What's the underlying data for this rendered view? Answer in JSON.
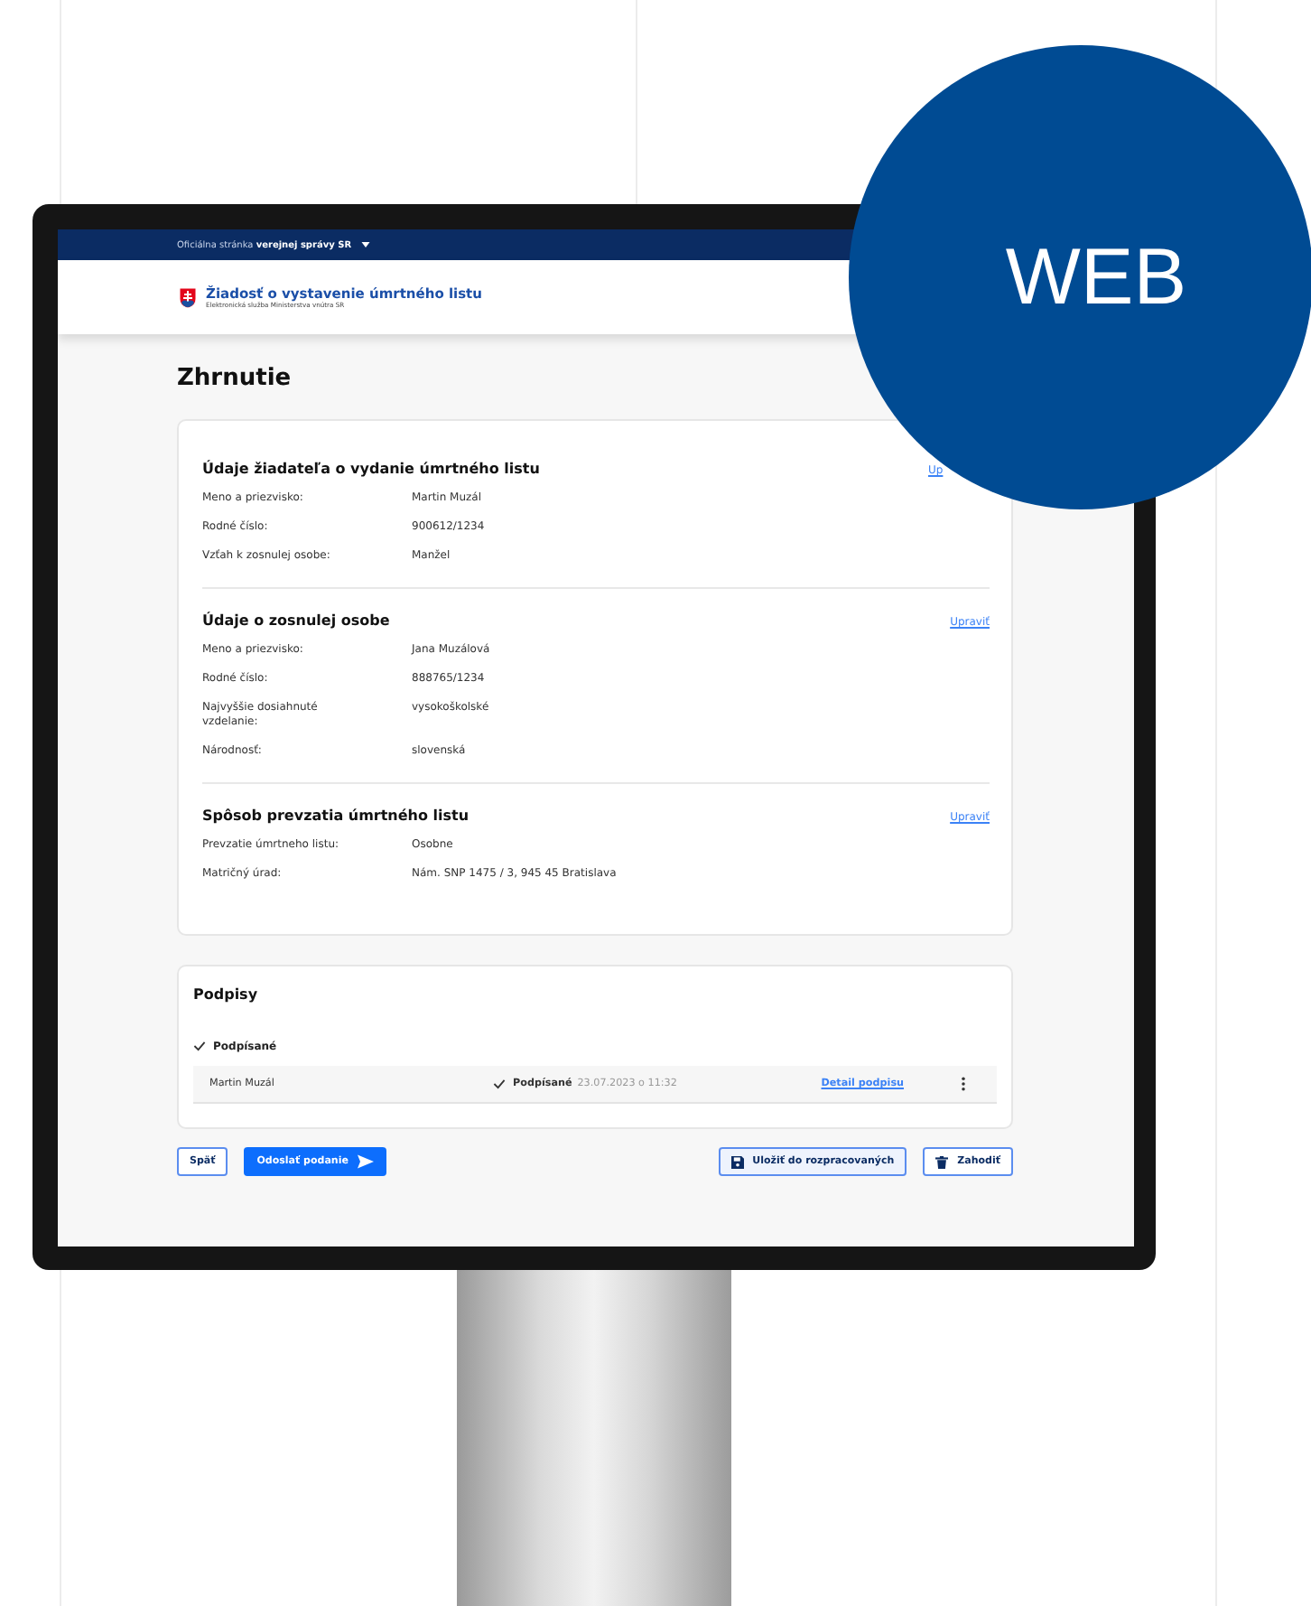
{
  "top_bar": {
    "text": "Oficiálna stránka **verejnej správy SR**"
  },
  "header": {
    "title": "Žiadosť o vystavenie úmrtného listu",
    "subtitle": "Elektronická služba Ministerstva vnútra SR"
  },
  "page_title": "Zhrnutie",
  "sections": [
    {
      "title": "Údaje žiadateľa o vydanie úmrtného listu",
      "edit_link": "Up",
      "rows": [
        {
          "label": "Meno a priezvisko:",
          "value": "Martin Muzál"
        },
        {
          "label": "Rodné číslo:",
          "value": "900612/1234"
        },
        {
          "label": "Vzťah k zosnulej osobe:",
          "value": "Manžel"
        }
      ]
    },
    {
      "title": "Údaje o zosnulej osobe",
      "edit_link": "Upraviť",
      "rows": [
        {
          "label": "Meno a priezvisko:",
          "value": "Jana Muzálová"
        },
        {
          "label": "Rodné číslo:",
          "value": "888765/1234"
        },
        {
          "label": "Najvyššie dosiahnuté vzdelanie:",
          "value": "vysokoškolské"
        },
        {
          "label": "Národnosť:",
          "value": "slovenská"
        }
      ]
    },
    {
      "title": "Spôsob prevzatia úmrtného listu",
      "edit_link": "Upraviť",
      "rows": [
        {
          "label": "Prevzatie úmrtneho listu:",
          "value": "Osobne"
        },
        {
          "label": "Matričný úrad:",
          "value": "Nám. SNP 1475 / 3, 945 45 Bratislava"
        }
      ]
    }
  ],
  "signatures": {
    "title": "Podpisy",
    "group": "Podpísané",
    "rows": [
      {
        "name": "Martin Muzál",
        "status": "Podpísané",
        "date": "23.07.2023 o 11:32",
        "link": "Detail podpisu"
      }
    ]
  },
  "buttons_left": [
    {
      "label": "Späť",
      "kind": "back"
    },
    {
      "label": "Odoslať podanie",
      "kind": "send"
    }
  ],
  "buttons_right": [
    {
      "label": "Uložiť do rozpracovaných",
      "kind": "save"
    },
    {
      "label": "Zahodiť",
      "kind": "discard"
    }
  ],
  "badge": "WEB"
}
